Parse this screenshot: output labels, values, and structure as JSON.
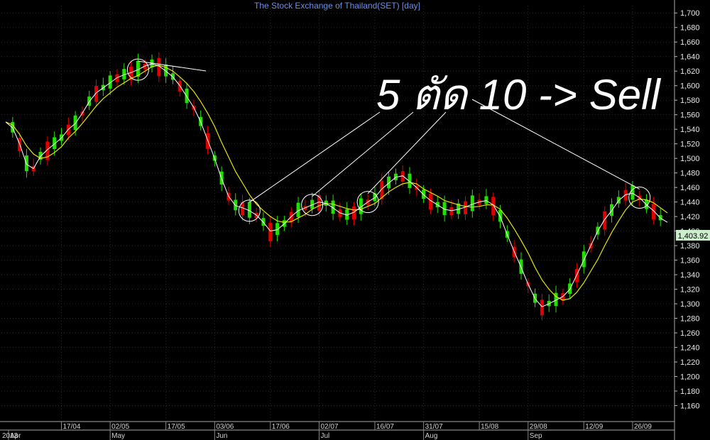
{
  "chart_data": {
    "type": "line",
    "title": "The Stock Exchange of Thailand(SET) [day]",
    "ylim": [
      1140,
      1710
    ],
    "ylabels": [
      "1,700",
      "1,680",
      "1,660",
      "1,640",
      "1,620",
      "1,600",
      "1,580",
      "1,560",
      "1,540",
      "1,520",
      "1,500",
      "1,480",
      "1,460",
      "1,440",
      "1,420",
      "1,400",
      "1,380",
      "1,360",
      "1,340",
      "1,320",
      "1,300",
      "1,280",
      "1,260",
      "1,240",
      "1,220",
      "1,200",
      "1,180",
      "1,160"
    ],
    "date_ticks": [
      "17/04",
      "02/05",
      "17/05",
      "03/06",
      "17/06",
      "02/07",
      "16/07",
      "31/07",
      "15/08",
      "29/08",
      "12/09",
      "26/09"
    ],
    "month_labels": [
      "Apr",
      "May",
      "Jun",
      "Jul",
      "Aug",
      "Sep"
    ],
    "year_label": "2013",
    "last_value_label": "1,403.92",
    "annotation": "5 ตัด 10 -> Sell",
    "colors": {
      "up": "#22e000",
      "down": "#e00000",
      "ma_fast": "#ffffff",
      "ma_slow": "#e6e600",
      "grid": "#2c2c2c",
      "title": "#6f8fe6",
      "pricetag_bg": "#cdeecd"
    },
    "series": [
      {
        "values": [
          1550,
          1542,
          1520,
          1492,
          1486,
          1503,
          1512,
          1520,
          1528,
          1540,
          1548,
          1562,
          1578,
          1590,
          1597,
          1604,
          1611,
          1615,
          1618,
          1622,
          1627,
          1630,
          1627,
          1620,
          1612,
          1600,
          1585,
          1570,
          1550,
          1525,
          1500,
          1472,
          1448,
          1435,
          1432,
          1428,
          1422,
          1412,
          1400,
          1402,
          1410,
          1420,
          1428,
          1432,
          1436,
          1440,
          1438,
          1432,
          1425,
          1422,
          1426,
          1433,
          1440,
          1446,
          1458,
          1466,
          1474,
          1476,
          1468,
          1460,
          1450,
          1442,
          1436,
          1430,
          1428,
          1430,
          1433,
          1437,
          1440,
          1442,
          1436,
          1420,
          1395,
          1372,
          1350,
          1327,
          1307,
          1296,
          1300,
          1305,
          1310,
          1320,
          1340,
          1360,
          1380,
          1400,
          1416,
          1428,
          1442,
          1450,
          1452,
          1446,
          1436,
          1428,
          1418,
          1412
        ]
      },
      {
        "values": [
          1550,
          1546,
          1533,
          1517,
          1506,
          1500,
          1502,
          1508,
          1516,
          1528,
          1537,
          1548,
          1560,
          1572,
          1582,
          1590,
          1598,
          1604,
          1610,
          1614,
          1620,
          1626,
          1628,
          1625,
          1620,
          1612,
          1603,
          1592,
          1578,
          1562,
          1544,
          1522,
          1502,
          1482,
          1466,
          1450,
          1437,
          1428,
          1420,
          1414,
          1412,
          1413,
          1418,
          1423,
          1430,
          1435,
          1438,
          1437,
          1434,
          1431,
          1429,
          1430,
          1434,
          1438,
          1446,
          1454,
          1460,
          1465,
          1467,
          1465,
          1458,
          1453,
          1448,
          1442,
          1439,
          1436,
          1434,
          1433,
          1434,
          1436,
          1436,
          1430,
          1418,
          1403,
          1387,
          1370,
          1350,
          1333,
          1320,
          1310,
          1305,
          1307,
          1316,
          1329,
          1345,
          1361,
          1380,
          1398,
          1414,
          1429,
          1440,
          1444,
          1443,
          1439,
          1432,
          1425
        ]
      }
    ]
  }
}
